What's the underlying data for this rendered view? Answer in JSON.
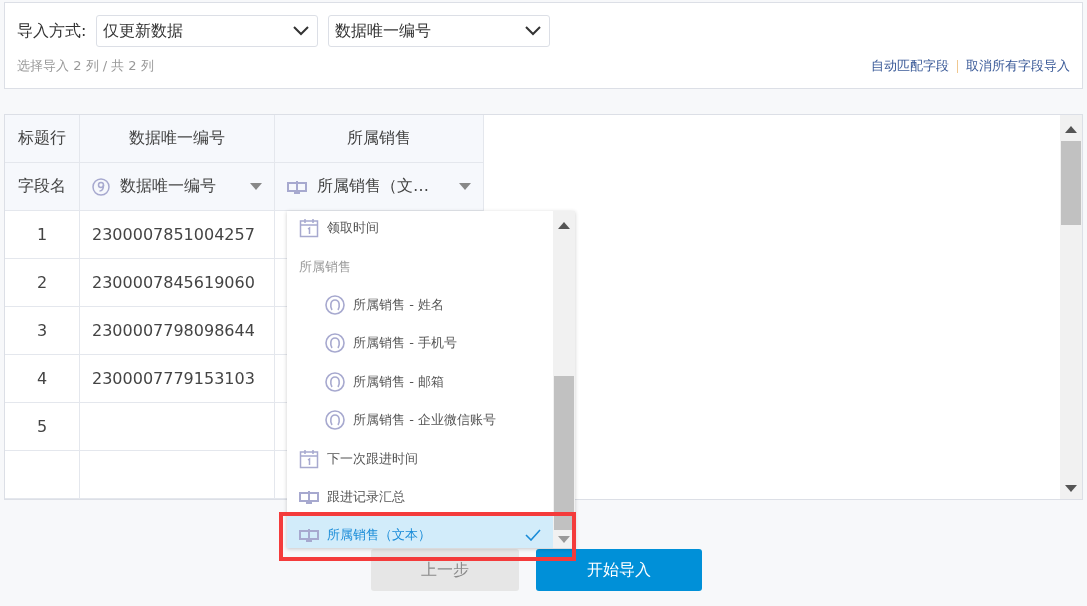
{
  "import_mode": {
    "label": "导入方式:",
    "mode": "仅更新数据",
    "key": "数据唯一编号"
  },
  "selection_summary": "选择导入 2 列 / 共 2 列",
  "links": [
    "自动匹配字段",
    "取消所有字段导入"
  ],
  "table": {
    "header_row": [
      "标题行",
      "数据唯一编号",
      "所属销售"
    ],
    "field_row": {
      "label": "字段名",
      "fields": [
        {
          "kind": "number",
          "text": "数据唯一编号"
        },
        {
          "kind": "text",
          "text": "所属销售（文…"
        }
      ]
    },
    "rows": [
      {
        "index": "1",
        "id": "2300007851004257"
      },
      {
        "index": "2",
        "id": "2300007845619060"
      },
      {
        "index": "3",
        "id": "2300007798098644"
      },
      {
        "index": "4",
        "id": "2300007779153103"
      },
      {
        "index": "5"
      }
    ]
  },
  "dropdown": {
    "items": [
      {
        "kind": "date",
        "label": "领取时间",
        "selected": false
      },
      {
        "kind": "group",
        "label": "所属销售",
        "children": [
          {
            "kind": "person",
            "label": "所属销售 - 姓名",
            "selected": false
          },
          {
            "kind": "person",
            "label": "所属销售 - 手机号",
            "selected": false
          },
          {
            "kind": "person",
            "label": "所属销售 - 邮箱",
            "selected": false
          },
          {
            "kind": "person",
            "label": "所属销售 - 企业微信账号",
            "selected": false
          }
        ]
      },
      {
        "kind": "date",
        "label": "下一次跟进时间",
        "selected": false
      },
      {
        "kind": "text",
        "label": "跟进记录汇总",
        "selected": false
      },
      {
        "kind": "text",
        "label": "所属销售（文本）",
        "selected": true
      }
    ]
  },
  "buttons": [
    {
      "label": "上一步",
      "disabled": true
    },
    {
      "label": "开始导入",
      "disabled": false
    }
  ]
}
